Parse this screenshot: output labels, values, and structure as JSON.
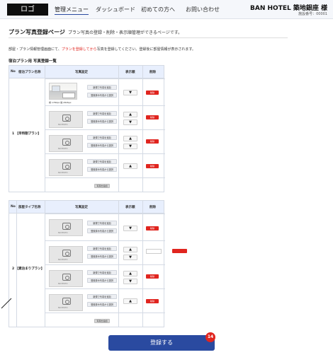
{
  "header": {
    "logo": "ロゴ",
    "nav": [
      "管理メニュー",
      "ダッシュボード",
      "初めての方へ",
      "お問い合わせ"
    ],
    "hotel_name": "BAN HOTEL 築地銀座 様",
    "hotel_id": "施設番号：00001"
  },
  "page": {
    "title": "プラン写真登録ページ",
    "description": "プラン写真の登録・削除・表示順管理ができるページです。",
    "notice_prefix": "部屋・プラン情報管理画面にて、",
    "notice_red": "プランを登録してから",
    "notice_suffix": "写真を登録してください。登録後に部屋情報が表示されます。",
    "section_label": "宿泊プラン用 写真登録一覧"
  },
  "table_common": {
    "col_no": "No",
    "col_photo": "写真設定",
    "col_order": "表示順",
    "col_delete": "削除",
    "btn_new": "新規で写真を追加",
    "btn_existing": "登録済み写真から選択",
    "delete_label": "削除",
    "add_photo_label": "写真を追加",
    "up_arrow": "▲",
    "down_arrow": "▼",
    "no_image_caption": "NO PHOTO",
    "photo_size": "横 1780px 縦 2826px"
  },
  "table1": {
    "col_name": "宿泊プラン名称",
    "plan_label": "1 【早特割プラン】"
  },
  "table2": {
    "col_name": "部屋タイプ名称",
    "plan_label": "2 【素泊まりプラン】"
  },
  "footer": {
    "register_label": "登録する",
    "badge_count": "14"
  },
  "colors": {
    "primary": "#2a4aa0",
    "danger": "#e0251f",
    "table_header": "#e8effd"
  }
}
